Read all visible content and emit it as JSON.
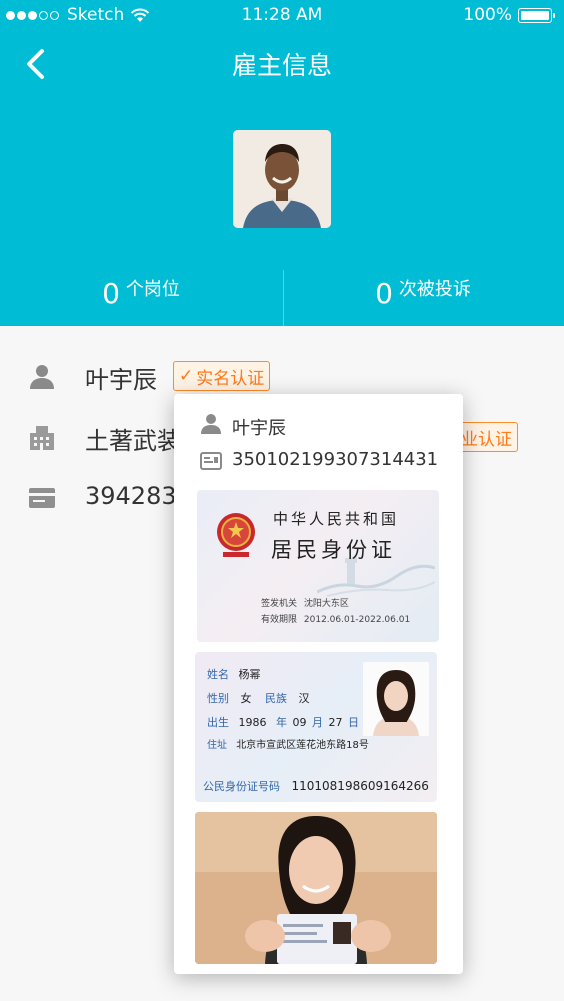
{
  "status_bar": {
    "carrier": "Sketch",
    "time": "11:28 AM",
    "battery": "100%"
  },
  "header": {
    "title": "雇主信息"
  },
  "stats": {
    "jobs_count": "0",
    "jobs_label": "个岗位",
    "complaints_count": "0",
    "complaints_label": "次被投诉"
  },
  "info": {
    "name": "叶宇辰",
    "realname_badge": "实名认证",
    "company_partial": "土著武装",
    "company_badge_partial": "业认证",
    "number_partial": "394283"
  },
  "popup": {
    "name": "叶宇辰",
    "id_number": "350102199307314431",
    "id_front": {
      "country": "中华人民共和国",
      "card_title": "居民身份证",
      "issuer_label": "签发机关",
      "issuer": "沈阳大东区",
      "validity_label": "有效期限",
      "validity": "2012.06.01-2022.06.01"
    },
    "id_back": {
      "name_label": "姓名",
      "name": "杨幂",
      "gender_label": "性别",
      "gender": "女",
      "ethnicity_label": "民族",
      "ethnicity": "汉",
      "birth_label": "出生",
      "birth_year": "1986",
      "year_unit": "年",
      "birth_month": "09",
      "month_unit": "月",
      "birth_day": "27",
      "day_unit": "日",
      "address_label": "住址",
      "address": "北京市宣武区莲花池东路18号",
      "id_label": "公民身份证号码",
      "id": "110108198609164266"
    }
  }
}
